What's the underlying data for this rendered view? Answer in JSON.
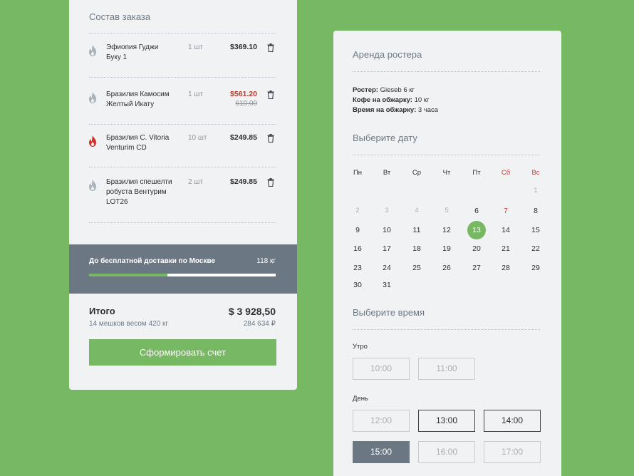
{
  "order": {
    "title": "Состав заказа",
    "items": [
      {
        "name_line1": "Эфиопия Гуджи",
        "name_line2": "Буку 1",
        "name_line3": "",
        "qty": "1 шт",
        "price": "$369.10",
        "old_price": "",
        "flame_color": "#a9b3bb"
      },
      {
        "name_line1": "Бразилия Камосим",
        "name_line2": "Желтый Икату",
        "name_line3": "",
        "qty": "1 шт",
        "price": "$561.20",
        "old_price": "610.00",
        "flame_color": "#a9b3bb"
      },
      {
        "name_line1": "Бразилия С. Vitoria",
        "name_line2": "Venturim CD",
        "name_line3": "",
        "qty": "10 шт",
        "price": "$249.85",
        "old_price": "",
        "flame_color": "#d0342c"
      },
      {
        "name_line1": "Бразилия спешелти",
        "name_line2": "робуста Вентурим",
        "name_line3": "LOT26",
        "qty": "2 шт",
        "price": "$249.85",
        "old_price": "",
        "flame_color": "#a9b3bb"
      }
    ],
    "delivery": {
      "label": "До бесплатной доставки по Москве",
      "weight": "118 кг",
      "progress": 0.42
    },
    "total": {
      "label": "Итого",
      "subtitle": "14 мешков весом 420 кг",
      "usd": "$ 3 928,50",
      "rub": "284 634 ₽"
    },
    "invoice_button": "Сформировать счет"
  },
  "rental": {
    "title": "Аренда ростера",
    "info": [
      {
        "label": "Ростер:",
        "value": "Gieseb 6 кг"
      },
      {
        "label": "Кофе на обжарку:",
        "value": "10 кг"
      },
      {
        "label": "Время на обжарку:",
        "value": "3 часа"
      }
    ],
    "date_title": "Выберите дату",
    "weekdays": [
      "Пн",
      "Вт",
      "Ср",
      "Чт",
      "Пт",
      "Сб",
      "Вс"
    ],
    "days": [
      {
        "num": "1",
        "state": "disabled"
      },
      {
        "num": "2",
        "state": "disabled"
      },
      {
        "num": "3",
        "state": "disabled"
      },
      {
        "num": "4",
        "state": "disabled"
      },
      {
        "num": "5",
        "state": "disabled"
      },
      {
        "num": "6",
        "state": "normal"
      },
      {
        "num": "7",
        "state": "weekend"
      },
      {
        "num": "8",
        "state": "normal"
      },
      {
        "num": "9",
        "state": "normal"
      },
      {
        "num": "10",
        "state": "normal"
      },
      {
        "num": "11",
        "state": "normal"
      },
      {
        "num": "12",
        "state": "normal"
      },
      {
        "num": "13",
        "state": "selected"
      },
      {
        "num": "14",
        "state": "normal"
      },
      {
        "num": "15",
        "state": "normal"
      },
      {
        "num": "16",
        "state": "normal"
      },
      {
        "num": "17",
        "state": "normal"
      },
      {
        "num": "18",
        "state": "normal"
      },
      {
        "num": "19",
        "state": "normal"
      },
      {
        "num": "20",
        "state": "normal"
      },
      {
        "num": "21",
        "state": "normal"
      },
      {
        "num": "22",
        "state": "normal"
      },
      {
        "num": "23",
        "state": "normal"
      },
      {
        "num": "24",
        "state": "normal"
      },
      {
        "num": "25",
        "state": "normal"
      },
      {
        "num": "26",
        "state": "normal"
      },
      {
        "num": "27",
        "state": "normal"
      },
      {
        "num": "28",
        "state": "normal"
      },
      {
        "num": "29",
        "state": "normal"
      },
      {
        "num": "30",
        "state": "normal"
      },
      {
        "num": "31",
        "state": "normal"
      }
    ],
    "time_title": "Выберите время",
    "morning_label": "Утро",
    "morning_slots": [
      {
        "time": "10:00",
        "state": "disabled"
      },
      {
        "time": "11:00",
        "state": "disabled"
      }
    ],
    "day_label": "День",
    "day_slots": [
      {
        "time": "12:00",
        "state": "disabled"
      },
      {
        "time": "13:00",
        "state": "available"
      },
      {
        "time": "14:00",
        "state": "available"
      },
      {
        "time": "15:00",
        "state": "chosen"
      },
      {
        "time": "16:00",
        "state": "disabled"
      },
      {
        "time": "17:00",
        "state": "disabled"
      }
    ]
  },
  "colors": {
    "accent": "#77b862",
    "sale": "#c0392b",
    "panel": "#6b7883"
  }
}
